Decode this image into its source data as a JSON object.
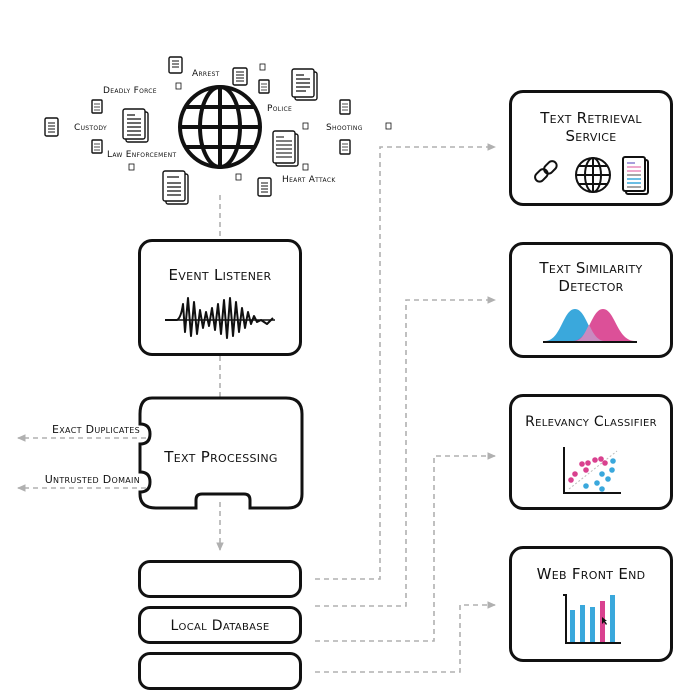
{
  "sources": {
    "keywords": [
      "Arrest",
      "Deadly Force",
      "Police",
      "Custody",
      "Shooting",
      "Law Enforcement",
      "Heart Attack"
    ],
    "center_icon": "globe-icon"
  },
  "pipeline": {
    "event_listener": {
      "title": "Event Listener",
      "icon": "waveform-icon"
    },
    "text_processing": {
      "title": "Text Processing",
      "outputs": [
        "Exact Duplicates",
        "Untrusted Domain"
      ]
    },
    "local_database": {
      "title": "Local Database"
    }
  },
  "services": [
    {
      "title_line1": "Text Retrieval",
      "title_line2": "Service",
      "icons": [
        "link-icon",
        "globe-icon",
        "document-icon"
      ]
    },
    {
      "title_line1": "Text Similarity",
      "title_line2": "Detector",
      "icon": "distribution-curves-icon"
    },
    {
      "title_line1": "Relevancy Classifier",
      "icon": "scatter-plot-icon"
    },
    {
      "title_line1": "Web Front End",
      "icon": "bar-chart-icon"
    }
  ],
  "colors": {
    "stroke": "#111111",
    "connector": "#b0b0b0",
    "blue": "#3aa8dc",
    "pink": "#d9418f"
  }
}
